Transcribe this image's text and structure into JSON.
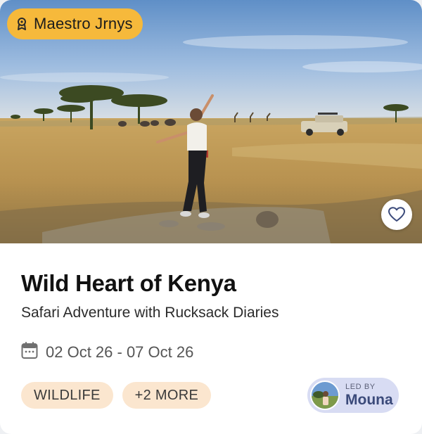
{
  "badge": {
    "label": "Maestro Jrnys",
    "icon": "award-badge-icon"
  },
  "favorite": {
    "icon": "heart-outline-icon"
  },
  "trip": {
    "title": "Wild Heart of Kenya",
    "subtitle": "Safari Adventure with Rucksack Diaries",
    "dates": "02 Oct 26 - 07 Oct 26",
    "date_icon": "calendar-icon"
  },
  "tags": [
    {
      "label": "WILDLIFE"
    },
    {
      "label": "+2 MORE"
    }
  ],
  "leader": {
    "caption": "LED BY",
    "name": "Mouna"
  },
  "colors": {
    "badge_bg": "#f6b93b",
    "tag_bg": "#fbe6cf",
    "leader_bg": "#d8dcf3",
    "leader_name": "#3b4a7a"
  }
}
